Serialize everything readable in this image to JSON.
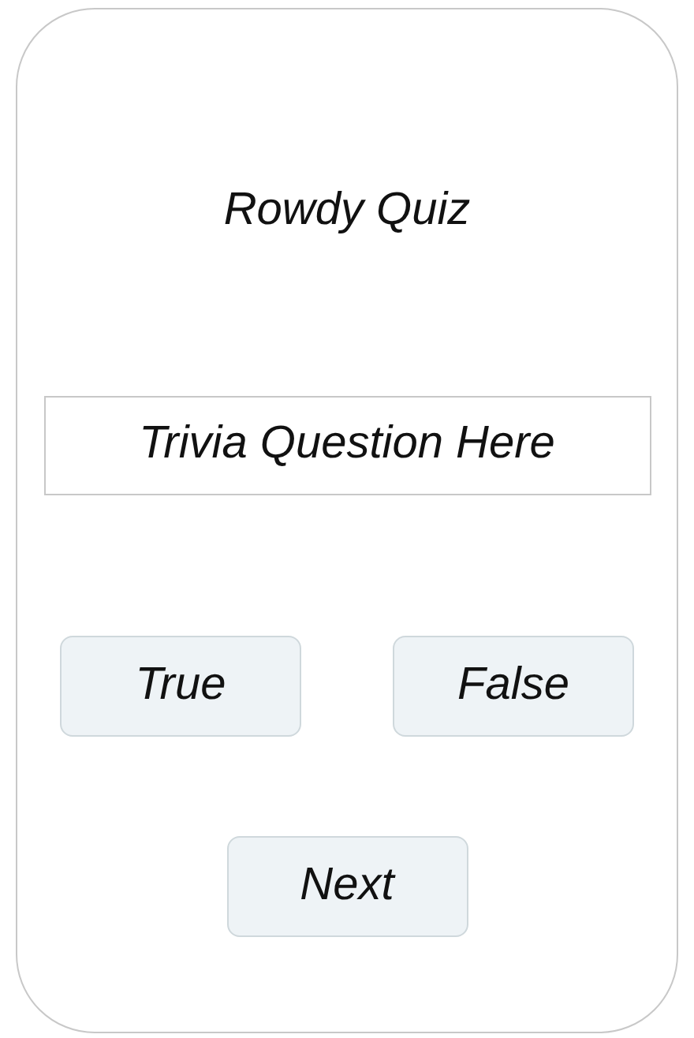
{
  "title": "Rowdy Quiz",
  "question": "Trivia Question Here",
  "answers": [
    {
      "label": "True"
    },
    {
      "label": "False"
    }
  ],
  "next_button": "Next"
}
